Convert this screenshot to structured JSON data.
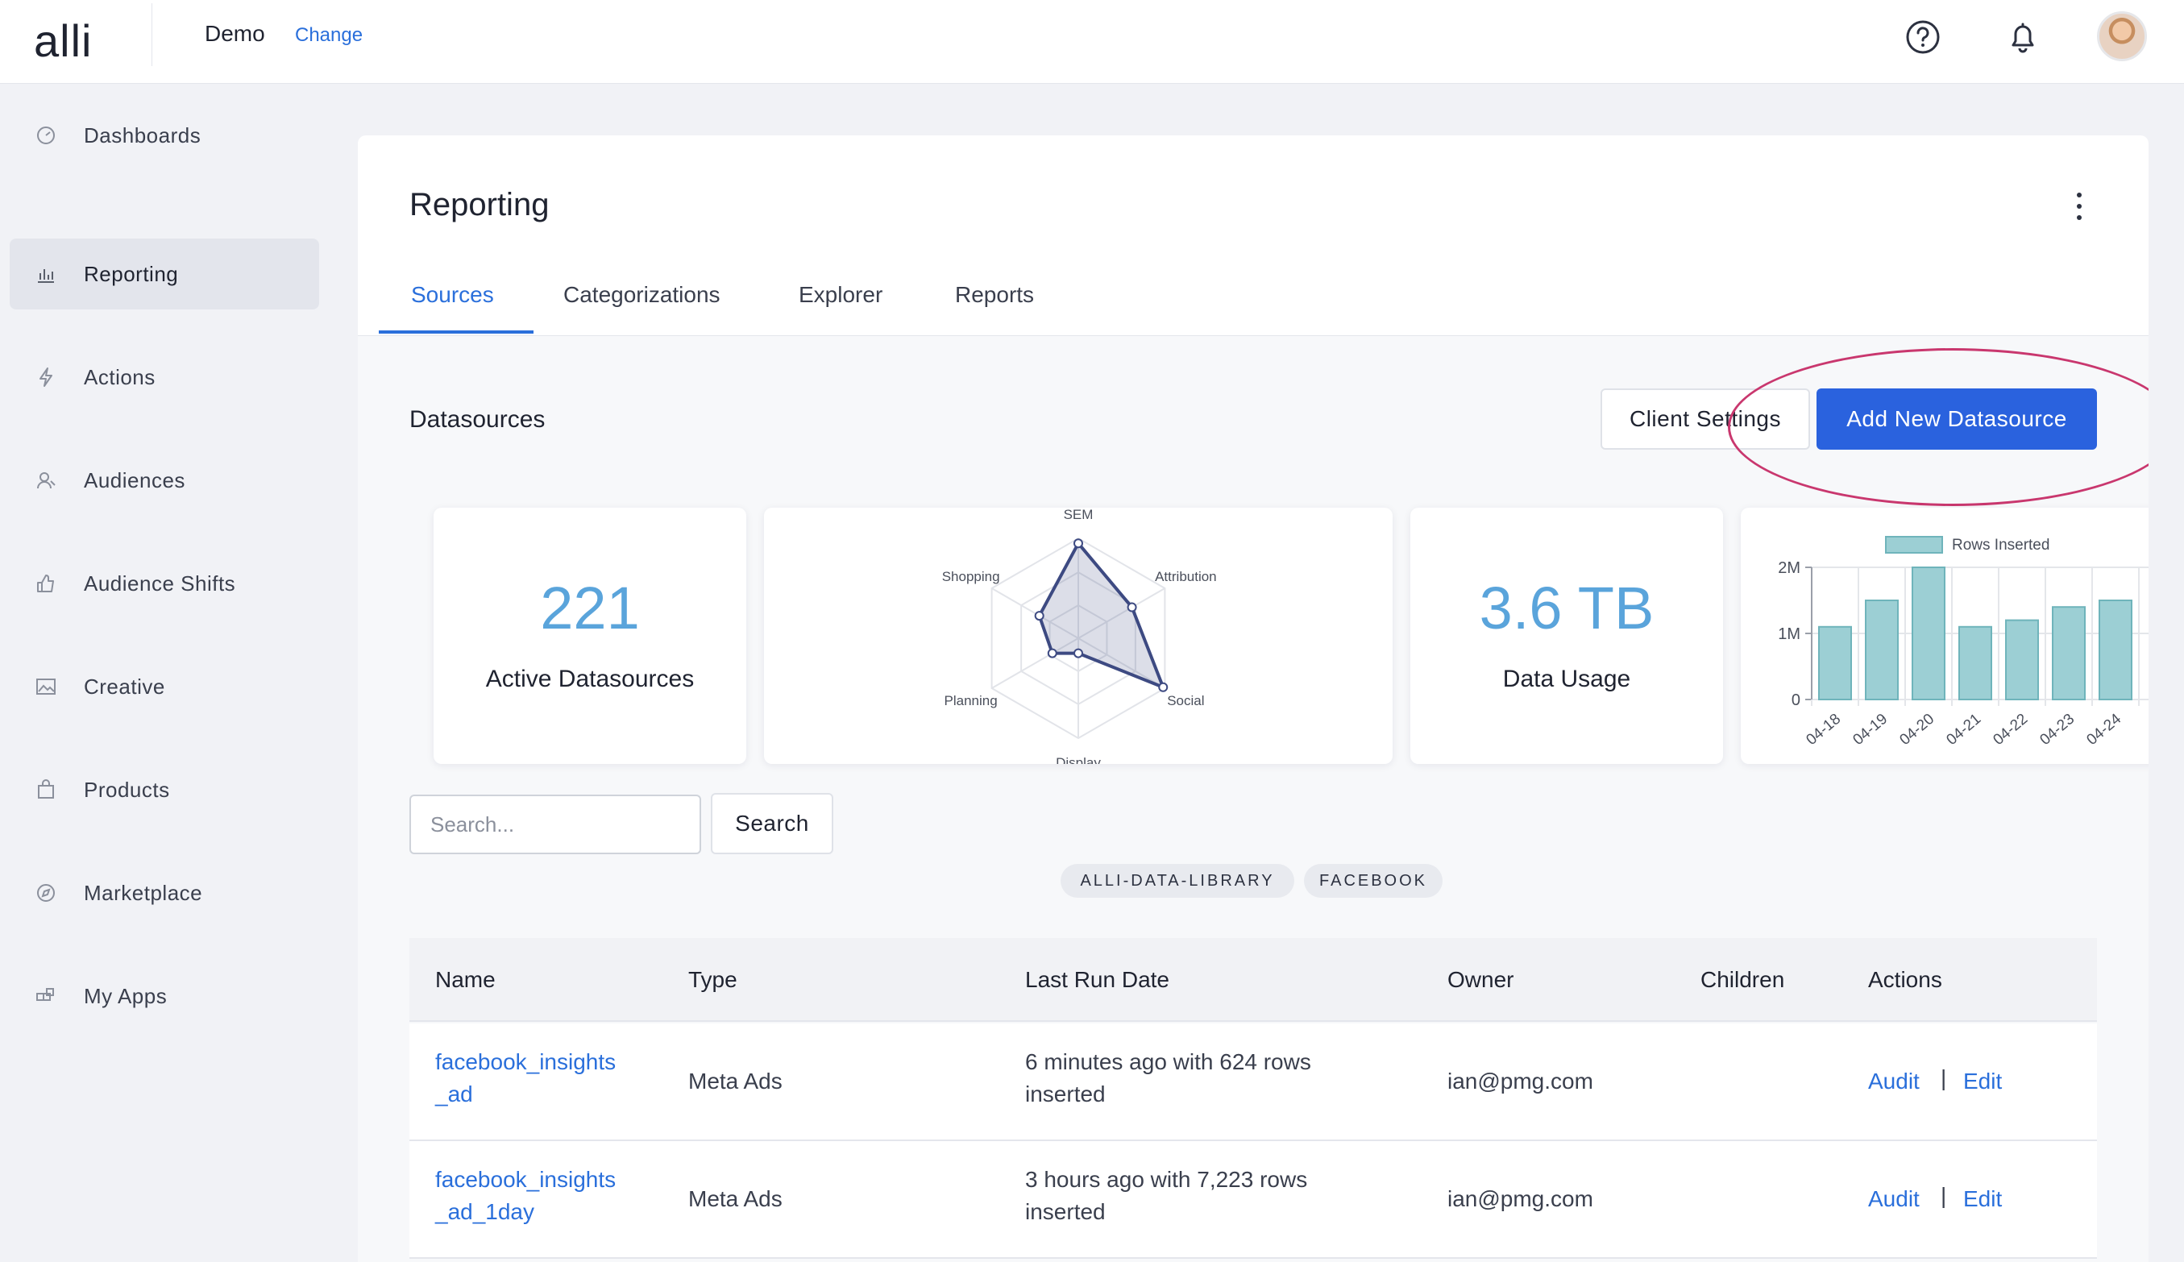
{
  "header": {
    "logo": "alli",
    "client": "Demo",
    "change_label": "Change",
    "help_icon": "help-icon",
    "bell_icon": "bell-icon"
  },
  "sidebar": {
    "items": [
      {
        "label": "Dashboards",
        "icon": "dashboard-icon"
      },
      {
        "label": "Reporting",
        "icon": "bar-chart-icon",
        "active": true
      },
      {
        "label": "Actions",
        "icon": "lightning-icon"
      },
      {
        "label": "Audiences",
        "icon": "audience-icon"
      },
      {
        "label": "Audience Shifts",
        "icon": "thumbs-up-icon"
      },
      {
        "label": "Creative",
        "icon": "image-icon"
      },
      {
        "label": "Products",
        "icon": "bag-icon"
      },
      {
        "label": "Marketplace",
        "icon": "compass-icon"
      },
      {
        "label": "My Apps",
        "icon": "apps-icon"
      }
    ]
  },
  "page": {
    "title": "Reporting",
    "tabs": [
      "Sources",
      "Categorizations",
      "Explorer",
      "Reports"
    ],
    "active_tab": "Sources"
  },
  "datasources": {
    "title": "Datasources",
    "client_settings_label": "Client Settings",
    "add_new_label": "Add New Datasource"
  },
  "stats": {
    "active_value": "221",
    "active_label": "Active Datasources",
    "usage_value": "3.6 TB",
    "usage_label": "Data Usage"
  },
  "chart_data": [
    {
      "type": "radar",
      "categories": [
        "SEM",
        "Attribution",
        "Social",
        "Display",
        "Planning",
        "Shopping"
      ],
      "values": [
        0.95,
        0.62,
        0.98,
        0.15,
        0.3,
        0.45
      ],
      "grid": true
    },
    {
      "type": "bar",
      "categories": [
        "04-18",
        "04-19",
        "04-20",
        "04-21",
        "04-22",
        "04-23",
        "04-24"
      ],
      "series": [
        {
          "name": "Rows Inserted",
          "values": [
            1100000,
            1500000,
            2000000,
            1100000,
            1200000,
            1400000,
            1500000
          ]
        }
      ],
      "yticks": [
        "2M",
        "1M",
        "0"
      ],
      "ylim": [
        0,
        2000000
      ],
      "legend": "top",
      "grid": true,
      "color": "#9ccfd4"
    }
  ],
  "search": {
    "placeholder": "Search...",
    "button_label": "Search",
    "chips": [
      "ALLI-DATA-LIBRARY",
      "FACEBOOK"
    ]
  },
  "table": {
    "headers": [
      "Name",
      "Type",
      "Last Run Date",
      "Owner",
      "Children",
      "Actions"
    ],
    "rows": [
      {
        "name_line1": "facebook_insights",
        "name_line2": "_ad",
        "type": "Meta Ads",
        "run_line1": "6 minutes ago with 624 rows",
        "run_line2": "inserted",
        "owner": "ian@pmg.com",
        "children": "",
        "audit": "Audit",
        "sep": "|",
        "edit": "Edit"
      },
      {
        "name_line1": "facebook_insights",
        "name_line2": "_ad_1day",
        "type": "Meta Ads",
        "run_line1": "3 hours ago with 7,223 rows",
        "run_line2": "inserted",
        "owner": "ian@pmg.com",
        "children": "",
        "audit": "Audit",
        "sep": "|",
        "edit": "Edit"
      }
    ]
  }
}
